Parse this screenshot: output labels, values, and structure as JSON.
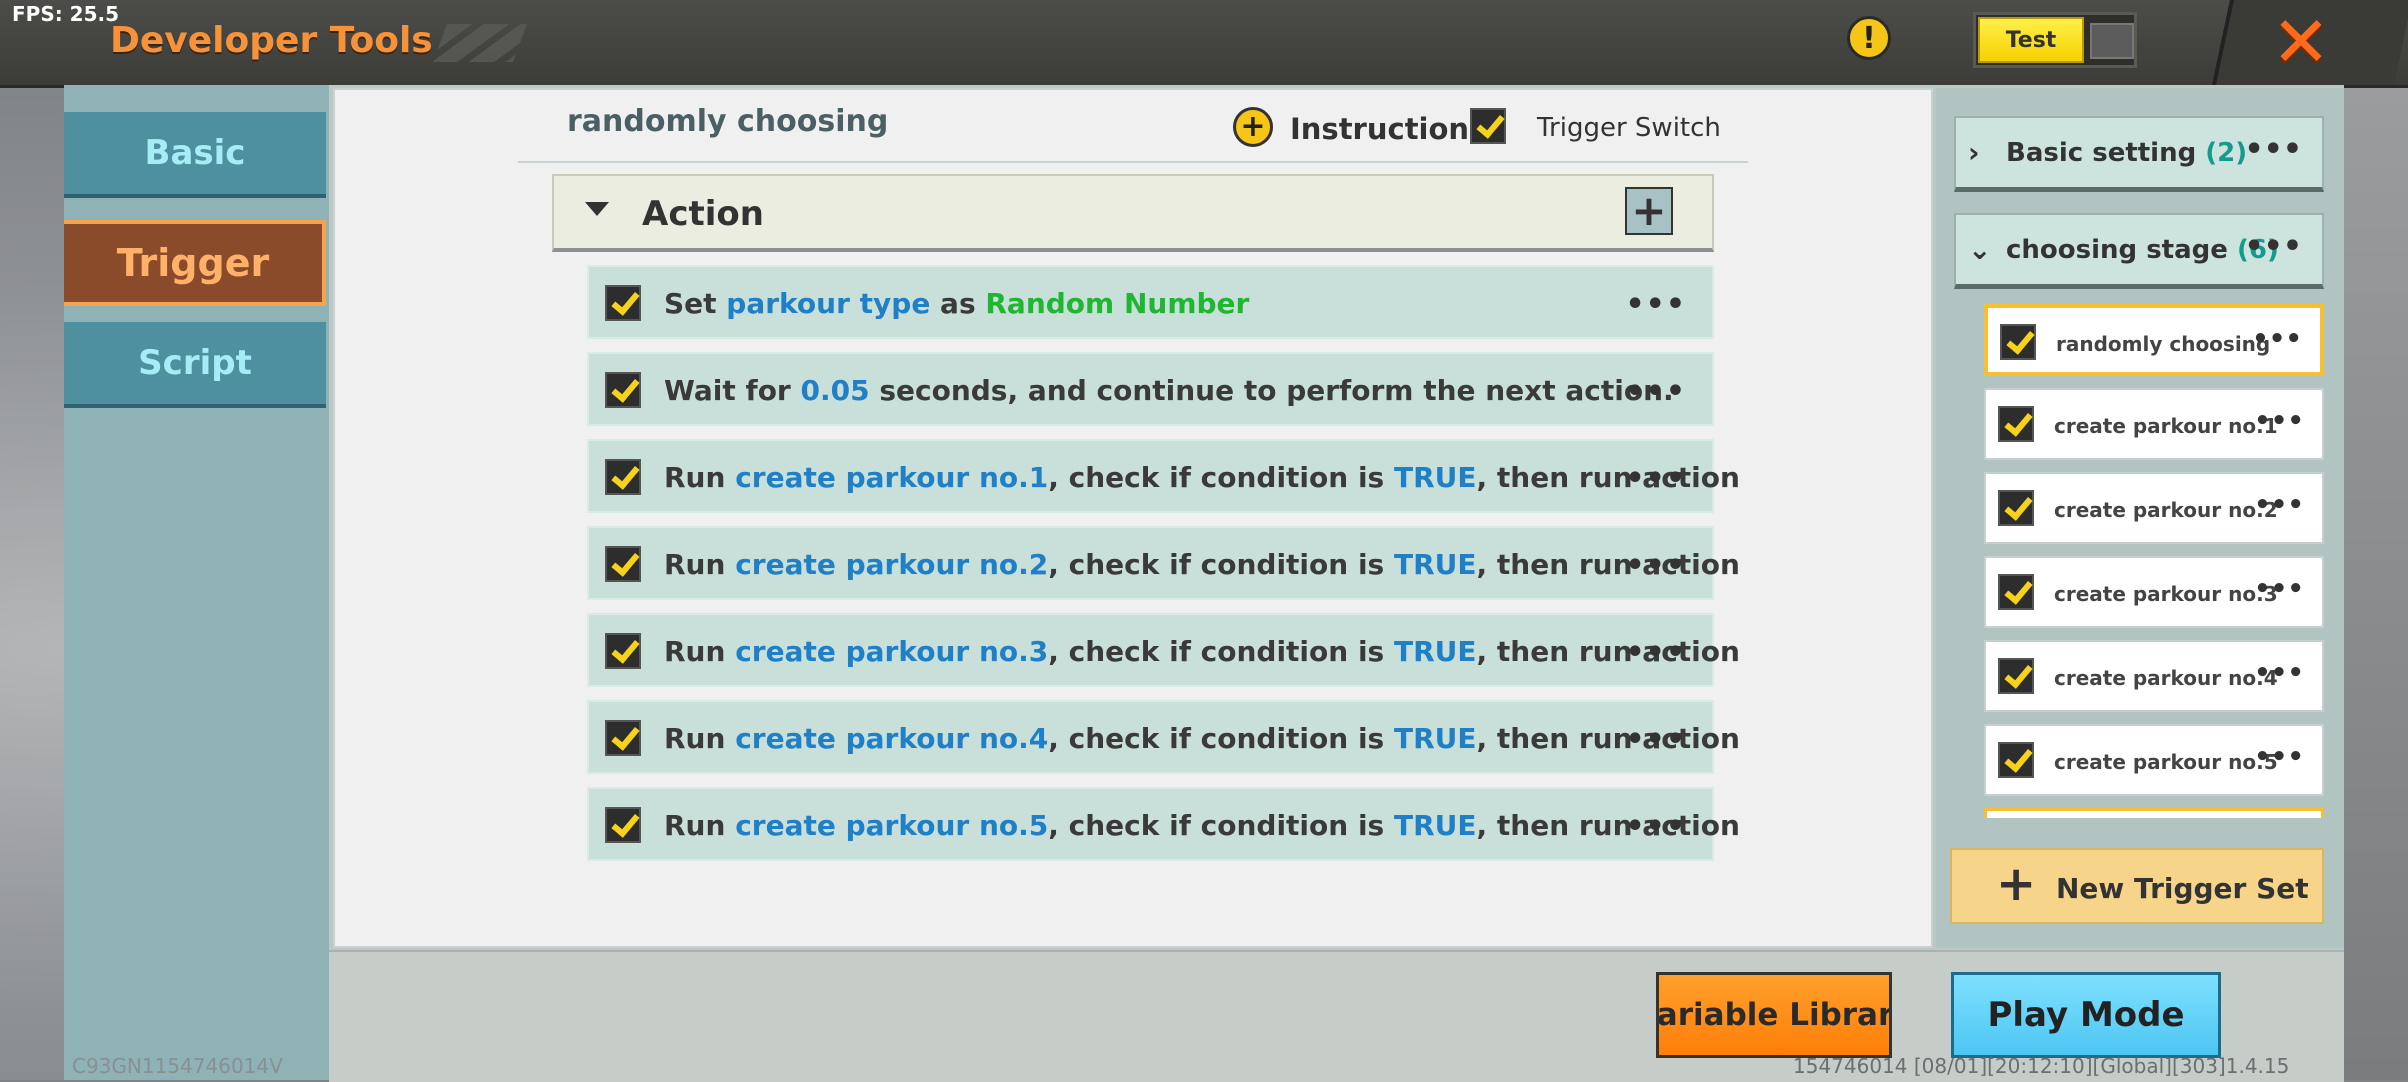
{
  "topbar": {
    "fps": "FPS: 25.5",
    "title": "Developer Tools",
    "test_label": "Test",
    "icons": {
      "warning": "warning-icon",
      "close": "close-icon"
    },
    "accent": "#f6923a"
  },
  "sidebar": {
    "items": [
      {
        "label": "Basic",
        "active": false
      },
      {
        "label": "Trigger",
        "active": true
      },
      {
        "label": "Script",
        "active": false
      }
    ]
  },
  "editor": {
    "trigger_name": "randomly choosing",
    "instruction_label": "Instruction",
    "trigger_switch_label": "Trigger Switch",
    "trigger_switch_on": true,
    "section_label": "Action",
    "actions": [
      {
        "enabled": true,
        "parts": [
          "Set ",
          "parkour type",
          " as ",
          "Random Number"
        ]
      },
      {
        "enabled": true,
        "parts": [
          "Wait for ",
          "0.05",
          " seconds, and continue to perform the next action."
        ]
      },
      {
        "enabled": true,
        "parts": [
          "Run ",
          "create parkour no.1",
          ", check if condition is ",
          "TRUE",
          ", then run action"
        ]
      },
      {
        "enabled": true,
        "parts": [
          "Run ",
          "create parkour no.2",
          ", check if condition is ",
          "TRUE",
          ", then run action"
        ]
      },
      {
        "enabled": true,
        "parts": [
          "Run ",
          "create parkour no.3",
          ", check if condition is ",
          "TRUE",
          ", then run action"
        ]
      },
      {
        "enabled": true,
        "parts": [
          "Run ",
          "create parkour no.4",
          ", check if condition is ",
          "TRUE",
          ", then run action"
        ]
      },
      {
        "enabled": true,
        "parts": [
          "Run ",
          "create parkour no.5",
          ", check if condition is ",
          "TRUE",
          ", then run action"
        ]
      }
    ],
    "more_glyph": "•••"
  },
  "trigger_list": {
    "groups": [
      {
        "label": "Basic setting",
        "count": "(2)",
        "expanded": false
      },
      {
        "label": "choosing stage",
        "count": "(6)",
        "expanded": true
      }
    ],
    "triggers": [
      {
        "label": "randomly choosing",
        "selected": true,
        "enabled": true
      },
      {
        "label": "create parkour no.1",
        "selected": false,
        "enabled": true
      },
      {
        "label": "create parkour no.2",
        "selected": false,
        "enabled": true
      },
      {
        "label": "create parkour no.3",
        "selected": false,
        "enabled": true
      },
      {
        "label": "create parkour no.4",
        "selected": false,
        "enabled": true
      },
      {
        "label": "create parkour no.5",
        "selected": false,
        "enabled": true
      }
    ],
    "new_trigger_label": "New Trigger Set"
  },
  "bottom": {
    "variable_library_label": "Variable Library",
    "play_mode_label": "Play Mode",
    "footer_left": "C93GN1154746014V",
    "footer_right": "154746014   [08/01][20:12:10][Global][303]1.4.15"
  },
  "colors": {
    "highlight_blue": "#1f7fc7",
    "highlight_green": "#1fb632",
    "checkbox_yellow": "#f7d21b",
    "selected_border": "#f7bf32"
  }
}
